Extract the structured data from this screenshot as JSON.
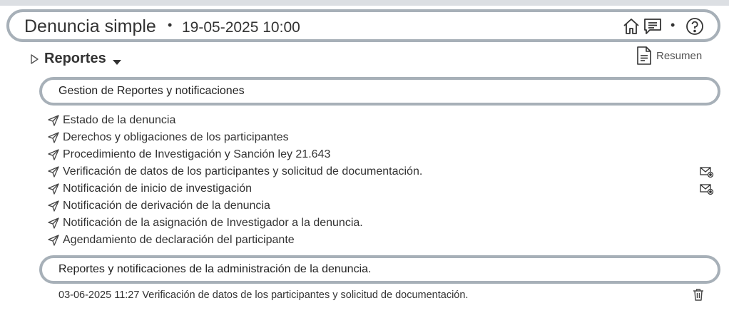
{
  "header": {
    "title": "Denuncia simple",
    "separator": "•",
    "datetime": "19-05-2025 10:00",
    "icons": [
      "home-icon",
      "chat-icon",
      "help-icon"
    ]
  },
  "section": {
    "title": "Reportes",
    "resumen_label": "Resumen"
  },
  "gestion": {
    "title": "Gestion de Reportes y notificaciones",
    "items": [
      {
        "label": "Estado de la denuncia",
        "mail": false
      },
      {
        "label": "Derechos y obligaciones de los participantes",
        "mail": false
      },
      {
        "label": "Procedimiento de Investigación y Sanción ley 21.643",
        "mail": false
      },
      {
        "label": "Verificación de datos de los participantes y solicitud de documentación.",
        "mail": true
      },
      {
        "label": "Notificación de inicio de investigación",
        "mail": true
      },
      {
        "label": "Notificación de derivación de la denuncia",
        "mail": false
      },
      {
        "label": "Notificación de la asignación de Investigador a la denuncia.",
        "mail": false
      },
      {
        "label": "Agendamiento de declaración del participante",
        "mail": false
      }
    ]
  },
  "admin": {
    "title": "Reportes y notificaciones de la administración de la denuncia.",
    "entries": [
      {
        "date": "03-06-2025 11:27",
        "label": "Verificación de datos de los participantes y solicitud de documentación."
      }
    ]
  },
  "colors": {
    "pill_border": "#a7b0b8",
    "text": "#333333",
    "topbar": "#dcdfe3"
  }
}
